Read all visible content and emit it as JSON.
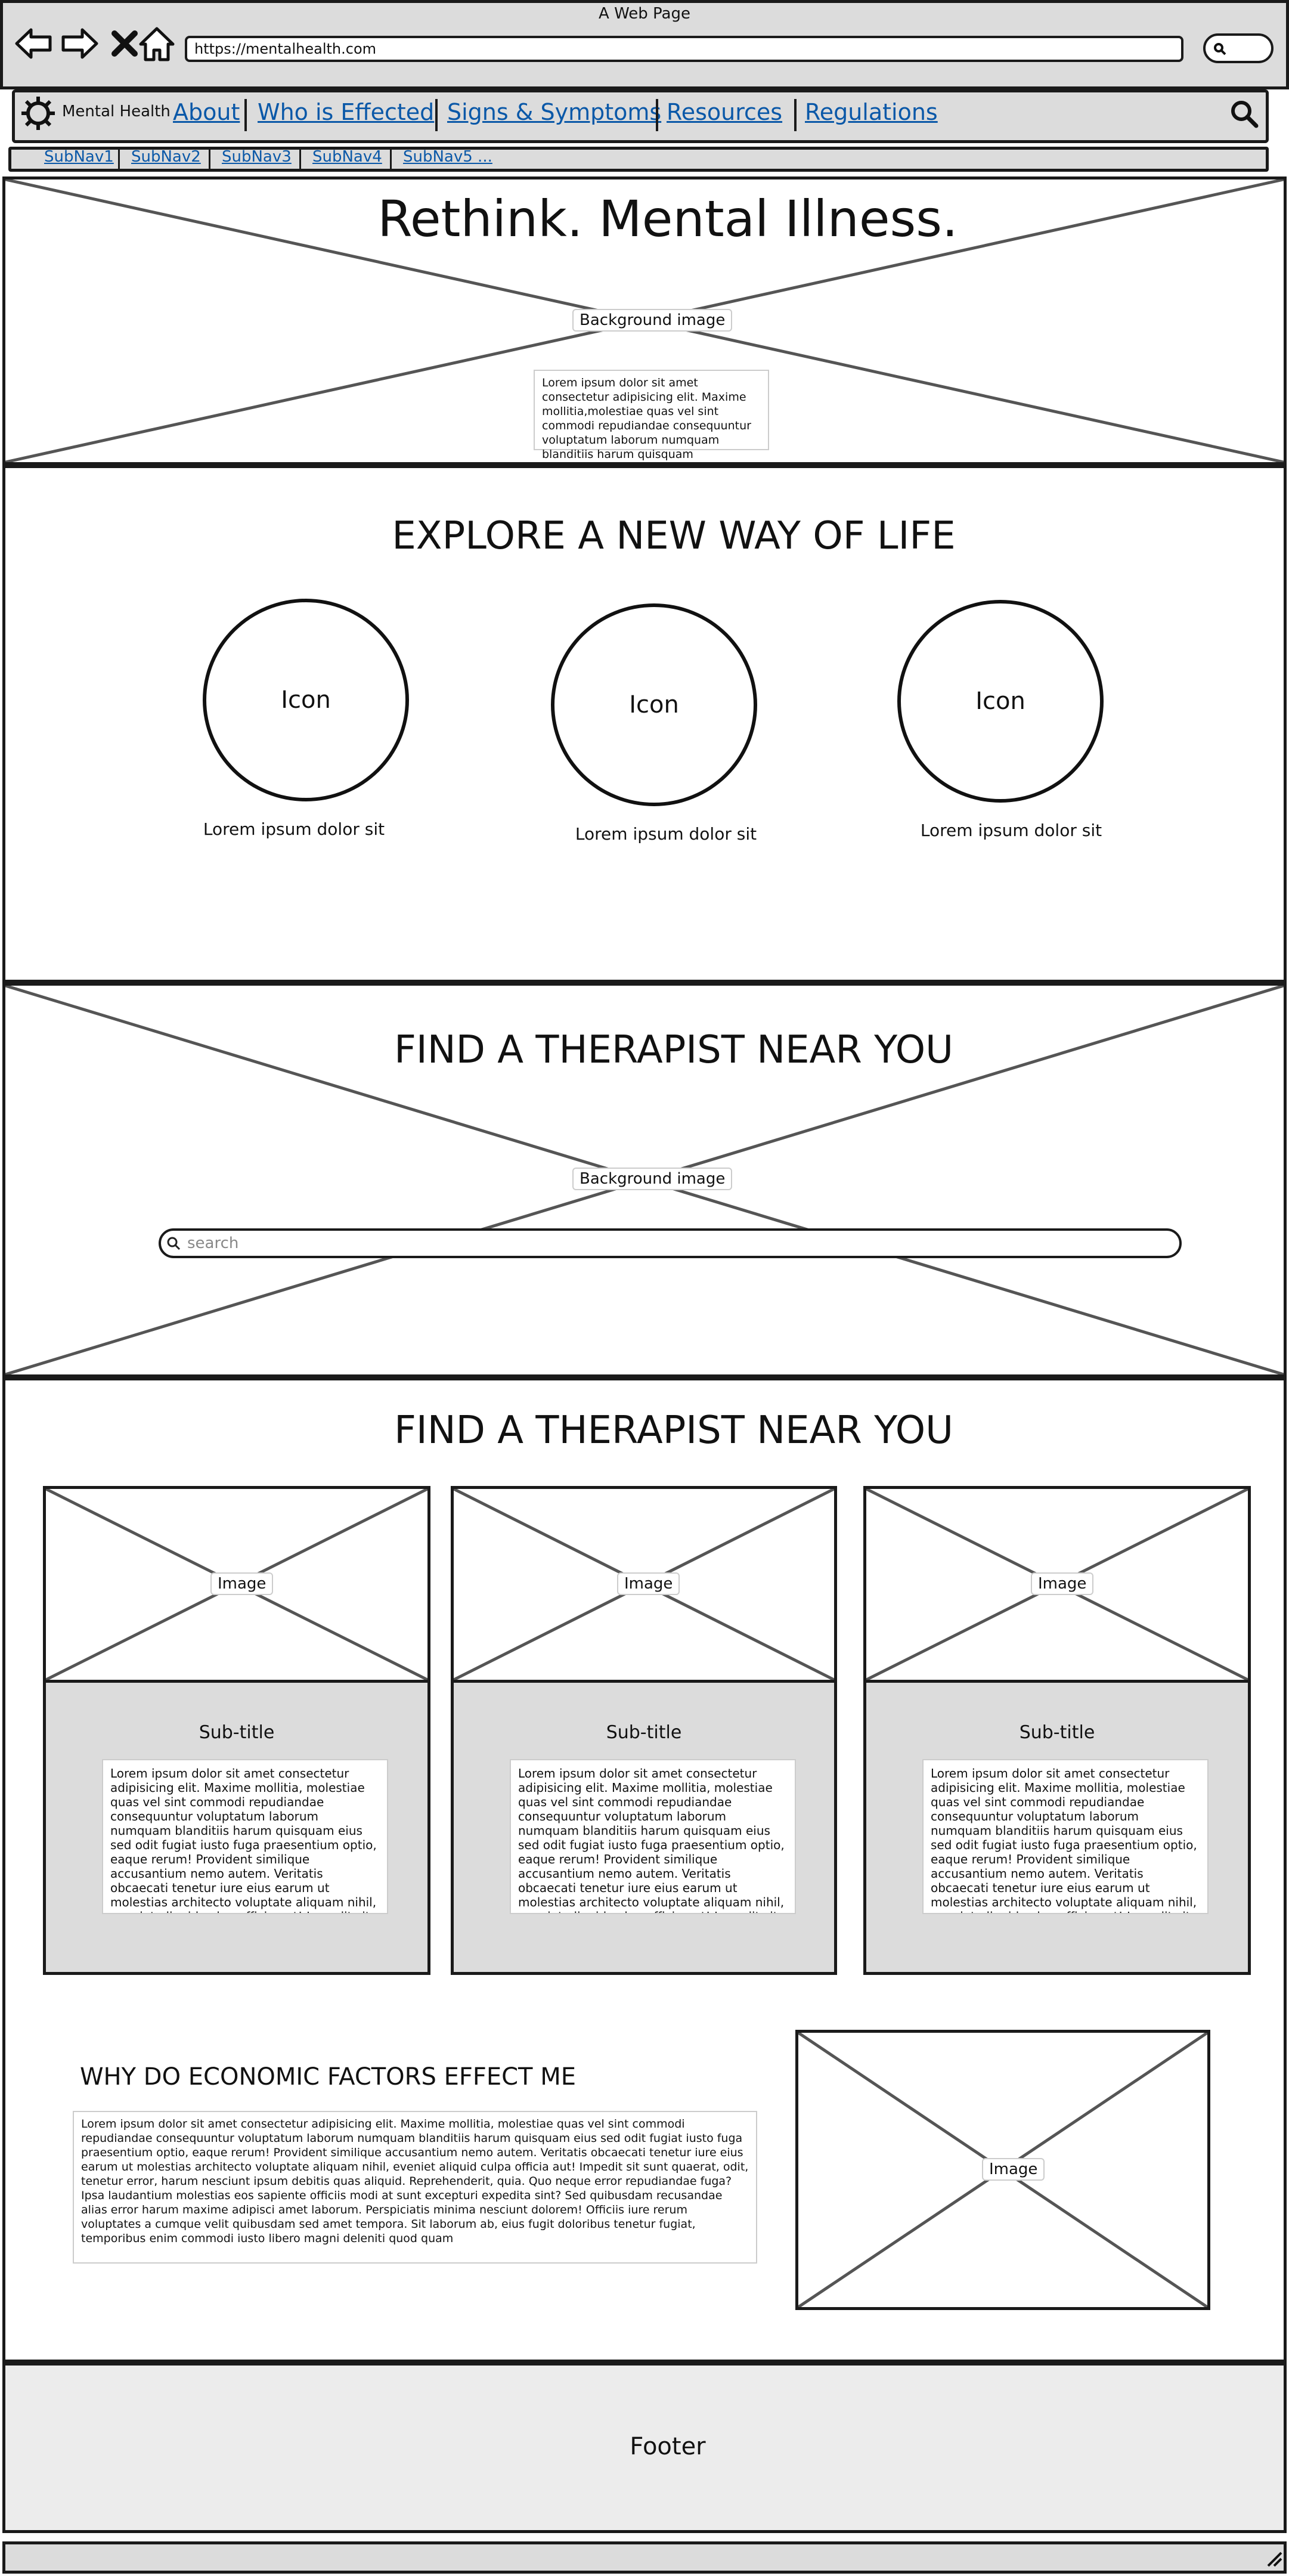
{
  "browser": {
    "window_title": "A Web Page",
    "url": "https://mentalhealth.com",
    "icons": [
      "back-arrow-icon",
      "forward-arrow-icon",
      "close-icon",
      "home-icon",
      "search-icon"
    ]
  },
  "site": {
    "logo_text": "Mental Health",
    "logo_icon": "gear-icon"
  },
  "nav": {
    "items": [
      "About",
      "Who is Effected",
      "Signs & Symptoms",
      "Resources",
      "Regulations"
    ],
    "search_icon": "search-icon"
  },
  "subnav": {
    "items": [
      "SubNav1",
      "SubNav2",
      "SubNav3",
      "SubNav4",
      "SubNav5 ..."
    ]
  },
  "hero": {
    "title": "Rethink. Mental Illness.",
    "background_label": "Background image",
    "text": "Lorem ipsum dolor sit amet consectetur adipisicing elit. Maxime mollitia,molestiae quas vel sint commodi repudiandae consequuntur voluptatum laborum numquam blanditiis harum quisquam"
  },
  "explore": {
    "title": "EXPLORE A NEW WAY OF LIFE",
    "items": [
      {
        "icon_label": "Icon",
        "caption": "Lorem ipsum dolor sit"
      },
      {
        "icon_label": "Icon",
        "caption": "Lorem ipsum dolor sit"
      },
      {
        "icon_label": "Icon",
        "caption": "Lorem ipsum dolor sit"
      }
    ]
  },
  "therapist_search": {
    "title": "FIND A THERAPIST NEAR YOU",
    "background_label": "Background image",
    "placeholder": "search"
  },
  "therapist_cards": {
    "title": "FIND A THERAPIST NEAR YOU",
    "cards": [
      {
        "image_label": "Image",
        "subtitle": "Sub-title",
        "text": "Lorem ipsum dolor sit amet consectetur adipisicing elit. Maxime mollitia, molestiae quas vel sint commodi repudiandae consequuntur voluptatum laborum numquam blanditiis harum quisquam eius sed odit fugiat iusto fuga praesentium optio, eaque rerum! Provident similique accusantium nemo autem. Veritatis obcaecati tenetur iure eius earum ut molestias architecto voluptate aliquam nihil, eveniet aliquid culpa officia aut! Impedit sit sunt quaerat, odit,"
      },
      {
        "image_label": "Image",
        "subtitle": "Sub-title",
        "text": "Lorem ipsum dolor sit amet consectetur adipisicing elit. Maxime mollitia, molestiae quas vel sint commodi repudiandae consequuntur voluptatum laborum numquam blanditiis harum quisquam eius sed odit fugiat iusto fuga praesentium optio, eaque rerum! Provident similique accusantium nemo autem. Veritatis obcaecati tenetur iure eius earum ut molestias architecto voluptate aliquam nihil, eveniet aliquid culpa officia aut! Impedit sit sunt quaerat, odit,"
      },
      {
        "image_label": "Image",
        "subtitle": "Sub-title",
        "text": "Lorem ipsum dolor sit amet consectetur adipisicing elit. Maxime mollitia, molestiae quas vel sint commodi repudiandae consequuntur voluptatum laborum numquam blanditiis harum quisquam eius sed odit fugiat iusto fuga praesentium optio, eaque rerum! Provident similique accusantium nemo autem. Veritatis obcaecati tenetur iure eius earum ut molestias architecto voluptate aliquam nihil, eveniet aliquid culpa officia aut! Impedit sit sunt quaerat, odit,"
      }
    ]
  },
  "economic": {
    "title": "WHY DO ECONOMIC FACTORS EFFECT ME",
    "text": "Lorem ipsum dolor sit amet consectetur adipisicing elit. Maxime mollitia, molestiae quas vel sint commodi repudiandae consequuntur voluptatum laborum numquam blanditiis harum quisquam eius sed odit fugiat iusto fuga praesentium optio, eaque rerum! Provident similique accusantium nemo autem. Veritatis obcaecati tenetur iure eius earum ut molestias architecto voluptate aliquam nihil, eveniet aliquid culpa officia aut! Impedit sit sunt quaerat, odit, tenetur error, harum nesciunt ipsum debitis quas aliquid. Reprehenderit, quia. Quo neque error repudiandae fuga? Ipsa laudantium molestias eos sapiente officiis modi at sunt excepturi expedita sint? Sed quibusdam recusandae alias error harum maxime adipisci amet laborum. Perspiciatis minima nesciunt dolorem! Officiis iure rerum voluptates a cumque velit quibusdam sed amet tempora. Sit laborum ab, eius fugit doloribus tenetur fugiat, temporibus enim commodi iusto libero magni deleniti quod quam",
    "image_label": "Image"
  },
  "footer": {
    "label": "Footer"
  }
}
